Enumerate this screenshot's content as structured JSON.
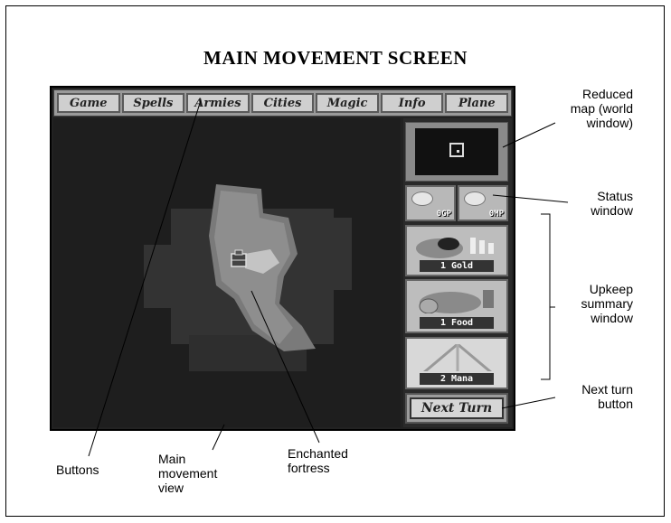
{
  "title": "MAIN MOVEMENT SCREEN",
  "menu": [
    "Game",
    "Spells",
    "Armies",
    "Cities",
    "Magic",
    "Info",
    "Plane"
  ],
  "status": {
    "gold": "0GP",
    "mana": "0MP"
  },
  "upkeep": {
    "gold": "1 Gold",
    "food": "1 Food",
    "mana": "2 Mana"
  },
  "next_turn_label": "Next Turn",
  "callouts": {
    "reduced_map": [
      "Reduced",
      "map (world",
      "window)"
    ],
    "status_window": [
      "Status",
      "window"
    ],
    "upkeep_window": [
      "Upkeep",
      "summary",
      "window"
    ],
    "next_turn": [
      "Next turn",
      "button"
    ],
    "buttons": "Buttons",
    "main_view": [
      "Main",
      "movement",
      "view"
    ],
    "fortress": [
      "Enchanted",
      "fortress"
    ]
  }
}
